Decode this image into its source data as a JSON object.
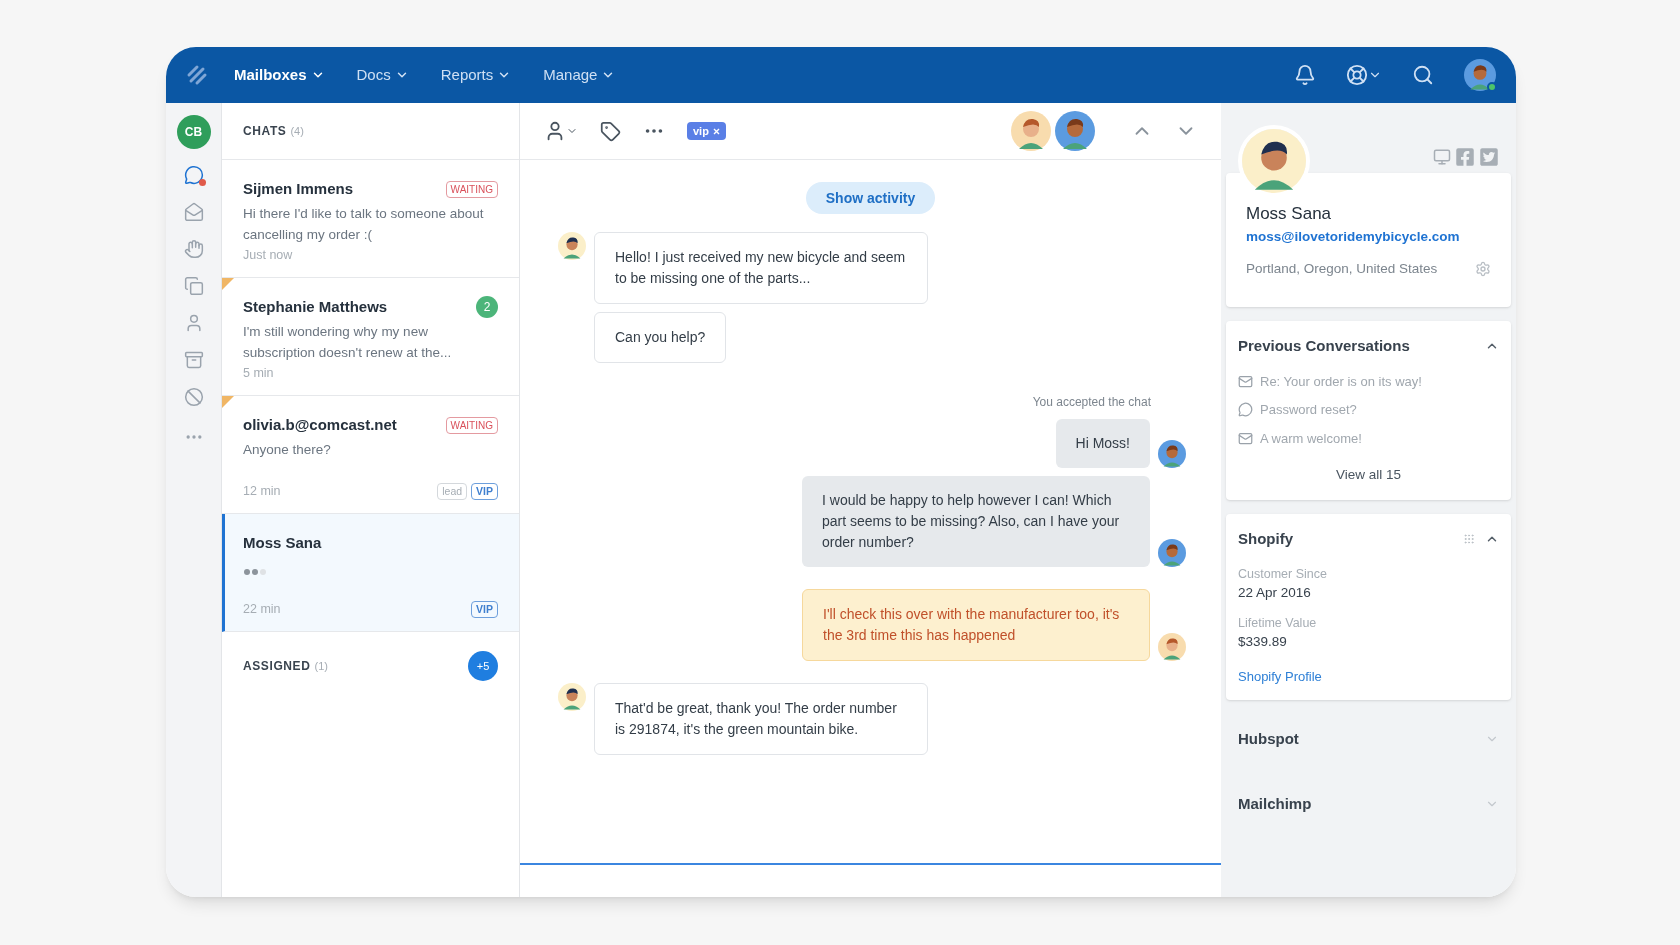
{
  "nav": {
    "menus": [
      {
        "label": "Mailboxes",
        "selected": true
      },
      {
        "label": "Docs",
        "selected": false
      },
      {
        "label": "Reports",
        "selected": false
      },
      {
        "label": "Manage",
        "selected": false
      }
    ],
    "user_online": true
  },
  "rail": {
    "initials": "CB",
    "items": [
      {
        "selected": true,
        "alert": true
      },
      {
        "selected": false,
        "alert": false
      },
      {
        "selected": false,
        "alert": false
      },
      {
        "selected": false,
        "alert": false
      },
      {
        "selected": false,
        "alert": false
      },
      {
        "selected": false,
        "alert": false
      },
      {
        "selected": false,
        "alert": false
      }
    ]
  },
  "chat_list": {
    "title": "CHATS",
    "count": "(4)",
    "chats": [
      {
        "name": "Sijmen Immens",
        "preview": "Hi there I'd like to talk to someone about cancelling my order :(",
        "time": "Just now",
        "status": "WAITING",
        "flagged": false,
        "selected": false,
        "typing": false
      },
      {
        "name": "Stephanie Matthews",
        "preview": "I'm still wondering why my new subscription doesn't renew at the...",
        "time": "5 min",
        "unread": "2",
        "flagged": true,
        "selected": false,
        "typing": false
      },
      {
        "name": "olivia.b@comcast.net",
        "preview": "Anyone there?",
        "time": "12 min",
        "status": "WAITING",
        "tags": [
          {
            "label": "lead",
            "kind": "plain"
          },
          {
            "label": "VIP",
            "kind": "vip"
          }
        ],
        "flagged": true,
        "selected": false,
        "typing": false
      },
      {
        "name": "Moss Sana",
        "time": "22 min",
        "tags": [
          {
            "label": "VIP",
            "kind": "vip"
          }
        ],
        "flagged": false,
        "selected": true,
        "typing": true
      }
    ],
    "assigned": {
      "title": "ASSIGNED",
      "count": "(1)",
      "badge": "+5"
    }
  },
  "conversation": {
    "tag": "vip",
    "show_activity": "Show activity",
    "messages": [
      {
        "kind": "customer",
        "text": "Hello! I just received my new bicycle and seem to be missing one of the parts...",
        "avatar": true
      },
      {
        "kind": "customer",
        "text": "Can you help?",
        "avatar": false
      },
      {
        "kind": "event",
        "text": "You accepted the chat"
      },
      {
        "kind": "agent",
        "text": "Hi Moss!",
        "avatar": true
      },
      {
        "kind": "agent",
        "text": "I would be happy to help however I can! Which part seems to be missing? Also, can I have your order number?",
        "avatar": true
      },
      {
        "kind": "note",
        "text": "I'll check this over with the manufacturer too, it's the 3rd time this has happened",
        "avatar": true
      },
      {
        "kind": "customer",
        "text": "That'd be great, thank you! The order number is 291874, it's the green mountain bike.",
        "avatar": true
      }
    ]
  },
  "profile": {
    "name": "Moss Sana",
    "email": "moss@ilovetoridemybicycle.com",
    "location": "Portland, Oregon, United States"
  },
  "previous_conversations": {
    "title": "Previous Conversations",
    "expanded": true,
    "items": [
      {
        "kind": "email",
        "text": "Re: Your order is on its way!"
      },
      {
        "kind": "chat",
        "text": "Password reset?"
      },
      {
        "kind": "email",
        "text": "A warm welcome!"
      }
    ],
    "link": "View all 15"
  },
  "integrations": [
    {
      "title": "Shopify",
      "expanded": true,
      "fields": [
        {
          "label": "Customer Since",
          "value": "22 Apr 2016"
        },
        {
          "label": "Lifetime Value",
          "value": "$339.89"
        }
      ],
      "link": "Shopify Profile"
    },
    {
      "title": "Hubspot",
      "expanded": false
    },
    {
      "title": "Mailchimp",
      "expanded": false
    }
  ]
}
